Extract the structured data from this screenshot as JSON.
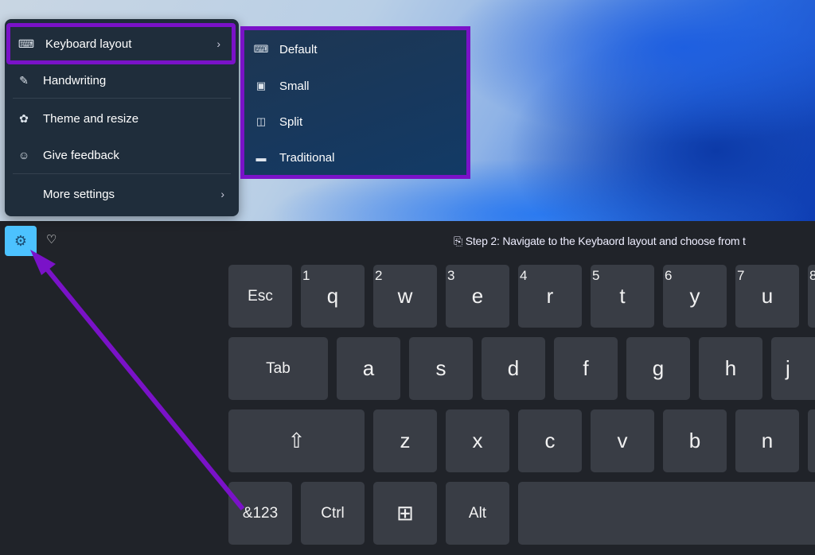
{
  "menu": {
    "items": [
      {
        "label": "Keyboard layout",
        "icon": "keyboard-icon",
        "submenu": true
      },
      {
        "label": "Handwriting",
        "icon": "handwriting-icon"
      },
      {
        "label": "Theme and resize",
        "icon": "palette-icon"
      },
      {
        "label": "Give feedback",
        "icon": "feedback-icon"
      },
      {
        "label": "More settings",
        "submenu": true
      }
    ]
  },
  "submenu": {
    "items": [
      {
        "label": "Default",
        "icon": "keyboard-default-icon"
      },
      {
        "label": "Small",
        "icon": "keyboard-small-icon"
      },
      {
        "label": "Split",
        "icon": "keyboard-split-icon"
      },
      {
        "label": "Traditional",
        "icon": "keyboard-traditional-icon"
      }
    ]
  },
  "toolbar": {
    "caption": "Step 2: Navigate to the Keybaord layout and choose from t"
  },
  "keys": {
    "row1": [
      {
        "l": "Esc"
      },
      {
        "l": "q",
        "n": "1"
      },
      {
        "l": "w",
        "n": "2"
      },
      {
        "l": "e",
        "n": "3"
      },
      {
        "l": "r",
        "n": "4"
      },
      {
        "l": "t",
        "n": "5"
      },
      {
        "l": "y",
        "n": "6"
      },
      {
        "l": "u",
        "n": "7"
      },
      {
        "l": "",
        "n": "8"
      }
    ],
    "row2": [
      {
        "l": "Tab"
      },
      {
        "l": "a"
      },
      {
        "l": "s"
      },
      {
        "l": "d"
      },
      {
        "l": "f"
      },
      {
        "l": "g"
      },
      {
        "l": "h"
      },
      {
        "l": "j"
      }
    ],
    "row3": [
      {
        "l": "⇧"
      },
      {
        "l": "z"
      },
      {
        "l": "x"
      },
      {
        "l": "c"
      },
      {
        "l": "v"
      },
      {
        "l": "b"
      },
      {
        "l": "n"
      },
      {
        "l": ""
      }
    ],
    "row4": [
      {
        "l": "&123"
      },
      {
        "l": "Ctrl"
      },
      {
        "l": "⊞"
      },
      {
        "l": "Alt"
      },
      {
        "l": ""
      }
    ]
  },
  "colors": {
    "highlight": "#7a12c8",
    "gear_active": "#4cc2ff"
  }
}
